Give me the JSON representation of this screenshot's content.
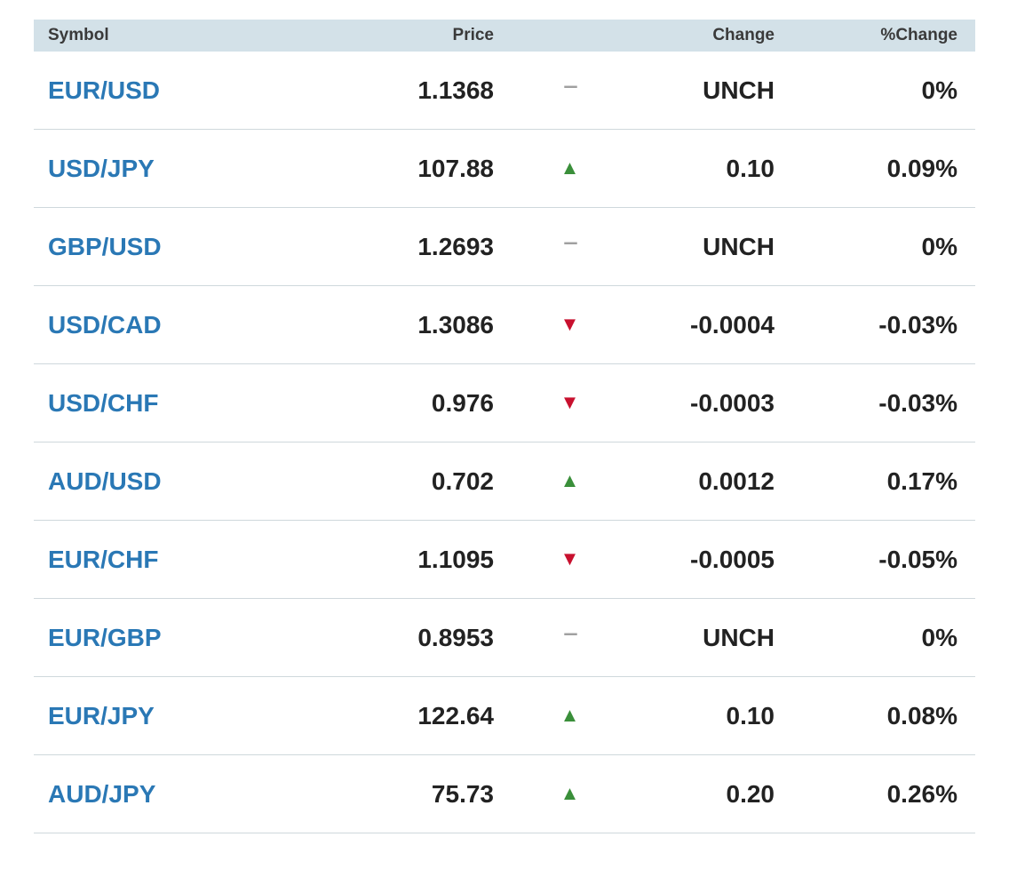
{
  "header": {
    "symbol": "Symbol",
    "price": "Price",
    "change": "Change",
    "pct_change": "%Change"
  },
  "rows": [
    {
      "symbol": "EUR/USD",
      "price": "1.1368",
      "indicator": "flat",
      "change": "UNCH",
      "pct": "0%"
    },
    {
      "symbol": "USD/JPY",
      "price": "107.88",
      "indicator": "up",
      "change": "0.10",
      "pct": "0.09%"
    },
    {
      "symbol": "GBP/USD",
      "price": "1.2693",
      "indicator": "flat",
      "change": "UNCH",
      "pct": "0%"
    },
    {
      "symbol": "USD/CAD",
      "price": "1.3086",
      "indicator": "down",
      "change": "-0.0004",
      "pct": "-0.03%"
    },
    {
      "symbol": "USD/CHF",
      "price": "0.976",
      "indicator": "down",
      "change": "-0.0003",
      "pct": "-0.03%"
    },
    {
      "symbol": "AUD/USD",
      "price": "0.702",
      "indicator": "up",
      "change": "0.0012",
      "pct": "0.17%"
    },
    {
      "symbol": "EUR/CHF",
      "price": "1.1095",
      "indicator": "down",
      "change": "-0.0005",
      "pct": "-0.05%"
    },
    {
      "symbol": "EUR/GBP",
      "price": "0.8953",
      "indicator": "flat",
      "change": "UNCH",
      "pct": "0%"
    },
    {
      "symbol": "EUR/JPY",
      "price": "122.64",
      "indicator": "up",
      "change": "0.10",
      "pct": "0.08%"
    },
    {
      "symbol": "AUD/JPY",
      "price": "75.73",
      "indicator": "up",
      "change": "0.20",
      "pct": "0.26%"
    }
  ],
  "indicator_icons": {
    "up": {
      "glyph": "▲",
      "name": "up-arrow-icon",
      "color": "#3a8f3a"
    },
    "down": {
      "glyph": "▼",
      "name": "down-arrow-icon",
      "color": "#c8102e"
    },
    "flat": {
      "glyph": "---",
      "name": "unchanged-dash-icon",
      "color": "#a0a0a0"
    }
  },
  "colors": {
    "header_bg": "#d3e1e8",
    "symbol_link": "#2a78b5",
    "row_divider": "#cfd8dc"
  }
}
